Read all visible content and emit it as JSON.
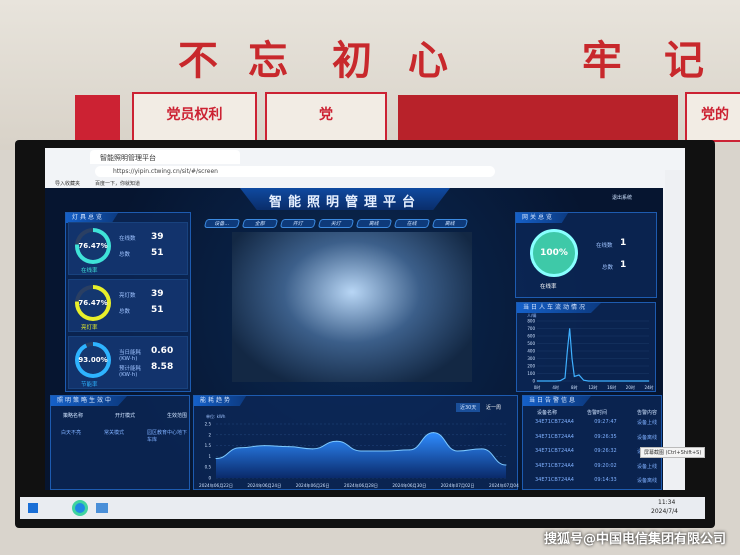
{
  "wall": {
    "slogan": [
      "不",
      "忘",
      "初",
      "心",
      "牢",
      "记"
    ],
    "banners": [
      "党员权利",
      "党",
      "党的"
    ]
  },
  "browser": {
    "tab_title": "智能照明管理平台",
    "url": "https://yipin.ctwing.cn/sit/#/screen",
    "favorites": [
      "导入收藏夹",
      "百度一下，你就知道"
    ],
    "tooltip": "屏幕截图 (Ctrl+Shift+S)"
  },
  "header": {
    "title": "智能照明管理平台",
    "exit": "退出系统"
  },
  "filters": [
    "设备...",
    "全部",
    "开灯",
    "关灯",
    "离线",
    "在线",
    "离线"
  ],
  "lamp_overview": {
    "title": "灯具总览",
    "cards": [
      {
        "percent": "76.47%",
        "caption": "在线率",
        "rows": [
          {
            "label": "在线数",
            "value": "39"
          },
          {
            "label": "总数",
            "value": "51"
          }
        ],
        "fraction": 0.7647,
        "color": "#3fe3d8"
      },
      {
        "percent": "76.47%",
        "caption": "亮灯率",
        "rows": [
          {
            "label": "亮灯数",
            "value": "39"
          },
          {
            "label": "总数",
            "value": "51"
          }
        ],
        "fraction": 0.7647,
        "color": "#e8ef2a"
      },
      {
        "percent": "93.00%",
        "caption": "节能率",
        "rows": [
          {
            "label": "当日能耗(KW·h)",
            "value": "0.60"
          },
          {
            "label": "预计能耗(KW·h)",
            "value": "8.58"
          }
        ],
        "fraction": 0.93,
        "color": "#2eb4ff"
      }
    ]
  },
  "gateway": {
    "title": "网关总览",
    "percent": "100%",
    "caption": "在线率",
    "rows": [
      {
        "label": "在线数",
        "value": "1"
      },
      {
        "label": "总数",
        "value": "1"
      }
    ]
  },
  "traffic": {
    "title": "当日人车流动情况"
  },
  "strategy": {
    "title": "照明策略生效中",
    "headers": [
      "策略名称",
      "开灯模式",
      "生效范围"
    ],
    "rows": [
      [
        "白天不亮",
        "常关模式",
        "园区教育中心地下车库"
      ]
    ]
  },
  "energy": {
    "title": "能耗趋势",
    "buttons": [
      "近30天",
      "近一周"
    ]
  },
  "alarms": {
    "title": "当日告警信息",
    "headers": [
      "设备名称",
      "告警时间",
      "告警内容"
    ],
    "rows": [
      [
        "34E71CB724A4",
        "09:27:47",
        "设备上线"
      ],
      [
        "34E71CB724A4",
        "09:26:35",
        "设备离线"
      ],
      [
        "34E71CB724A4",
        "09:26:32",
        "设备离线"
      ],
      [
        "34E71CB724A4",
        "09:20:02",
        "设备上线"
      ],
      [
        "34E71CB724A4",
        "09:14:33",
        "设备离线"
      ]
    ]
  },
  "taskbar": {
    "time": "11:34",
    "date": "2024/7/4"
  },
  "watermark": "搜狐号@中国电信集团有限公司",
  "chart_data": [
    {
      "type": "line",
      "title": "当日人车流动情况",
      "ylabel": "人/辆",
      "ylim": [
        0,
        800
      ],
      "yticks": [
        0,
        100,
        200,
        300,
        400,
        500,
        600,
        700,
        800
      ],
      "xticks": [
        "0时",
        "4时",
        "8时",
        "12时",
        "16时",
        "20时",
        "24时"
      ],
      "x": [
        0,
        4,
        5,
        6,
        6.5,
        7,
        7.5,
        8,
        9,
        10,
        11,
        12,
        24
      ],
      "y": [
        0,
        0,
        5,
        40,
        400,
        700,
        300,
        60,
        80,
        10,
        0,
        0,
        0
      ]
    },
    {
      "type": "area",
      "title": "能耗趋势",
      "ylabel": "单位: kWh",
      "ylim": [
        0,
        2.5
      ],
      "yticks": [
        "0",
        "0.5",
        "1",
        "1.5",
        "2",
        "2.5"
      ],
      "xticks": [
        "2024年06月22日",
        "2024年06月24日",
        "2024年06月26日",
        "2024年06月28日",
        "2024年06月30日",
        "2024年07月02日",
        "2024年07月04日"
      ],
      "x": [
        "06-22",
        "06-23",
        "06-24",
        "06-25",
        "06-26",
        "06-27",
        "06-28",
        "06-29",
        "06-30",
        "07-01",
        "07-02",
        "07-03",
        "07-04"
      ],
      "y": [
        0.9,
        1.4,
        1.5,
        1.45,
        1.35,
        1.7,
        1.25,
        1.25,
        1.3,
        2.1,
        1.25,
        1.35,
        0.6
      ]
    }
  ]
}
